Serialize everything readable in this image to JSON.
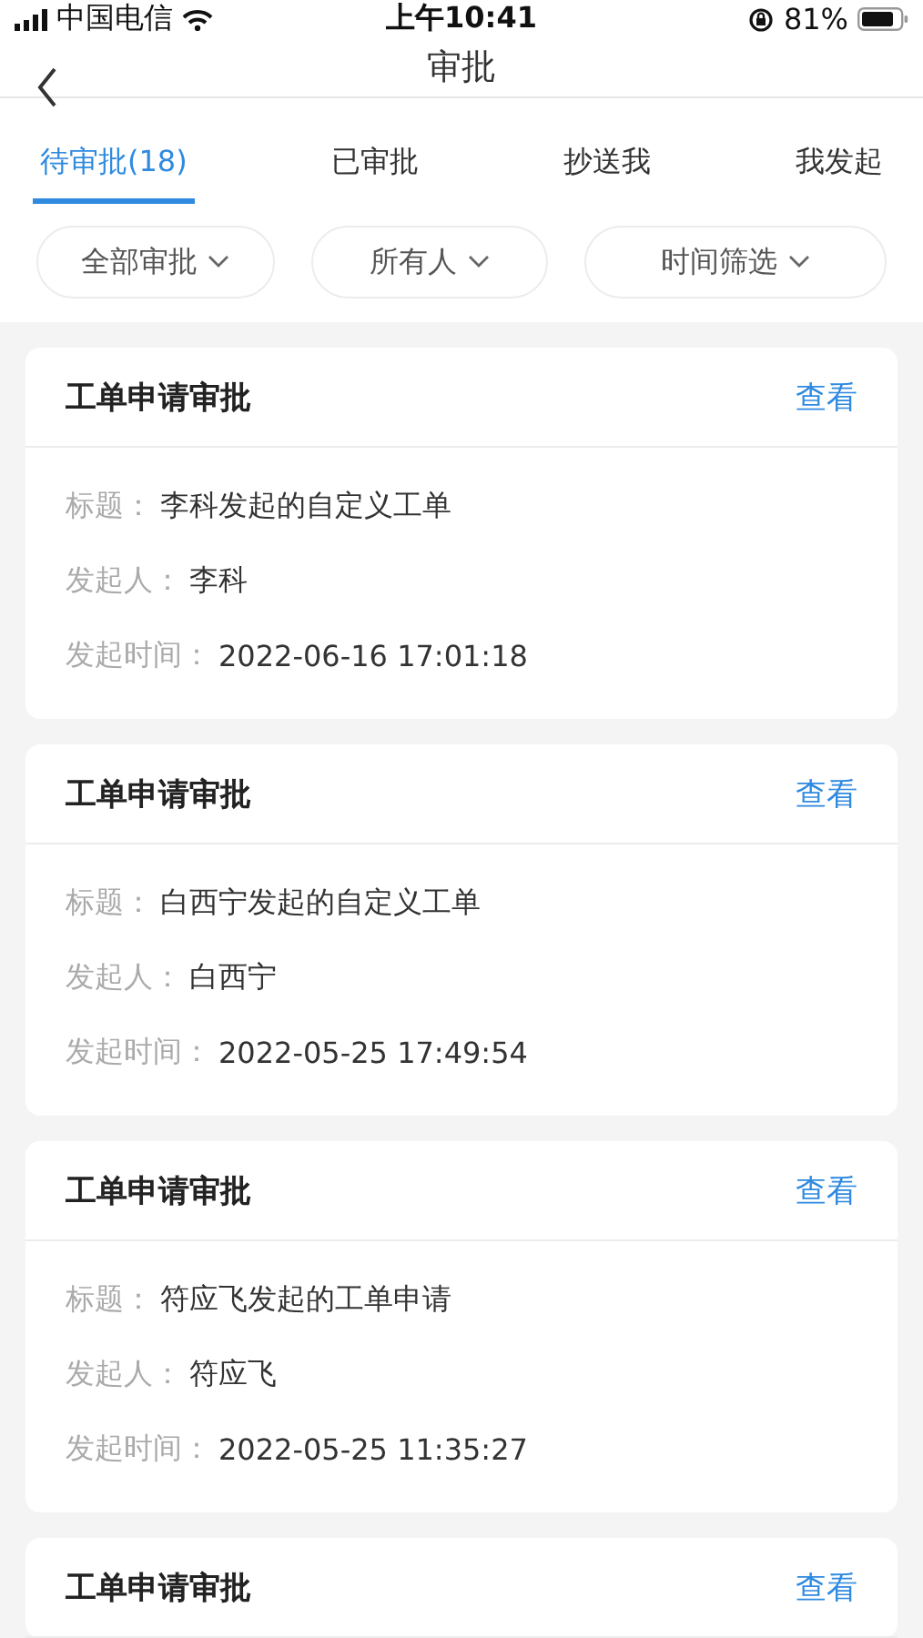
{
  "status_bar": {
    "carrier": "中国电信",
    "time": "上午10:41",
    "battery": "81%"
  },
  "nav": {
    "title": "审批"
  },
  "tabs": [
    {
      "label": "待审批(18)",
      "selected": true
    },
    {
      "label": "已审批",
      "selected": false
    },
    {
      "label": "抄送我",
      "selected": false
    },
    {
      "label": "我发起",
      "selected": false
    }
  ],
  "filters": [
    {
      "label": "全部审批"
    },
    {
      "label": "所有人"
    },
    {
      "label": "时间筛选"
    }
  ],
  "cards": [
    {
      "title": "工单申请审批",
      "action": "查看",
      "fields": [
        {
          "label": "标题：",
          "value": "李科发起的自定义工单"
        },
        {
          "label": "发起人：",
          "value": "李科"
        },
        {
          "label": "发起时间：",
          "value": "2022-06-16 17:01:18"
        }
      ]
    },
    {
      "title": "工单申请审批",
      "action": "查看",
      "fields": [
        {
          "label": "标题：",
          "value": "白西宁发起的自定义工单"
        },
        {
          "label": "发起人：",
          "value": "白西宁"
        },
        {
          "label": "发起时间：",
          "value": "2022-05-25 17:49:54"
        }
      ]
    },
    {
      "title": "工单申请审批",
      "action": "查看",
      "fields": [
        {
          "label": "标题：",
          "value": "符应飞发起的工单申请"
        },
        {
          "label": "发起人：",
          "value": "符应飞"
        },
        {
          "label": "发起时间：",
          "value": "2022-05-25 11:35:27"
        }
      ]
    },
    {
      "title": "工单申请审批",
      "action": "查看"
    }
  ]
}
